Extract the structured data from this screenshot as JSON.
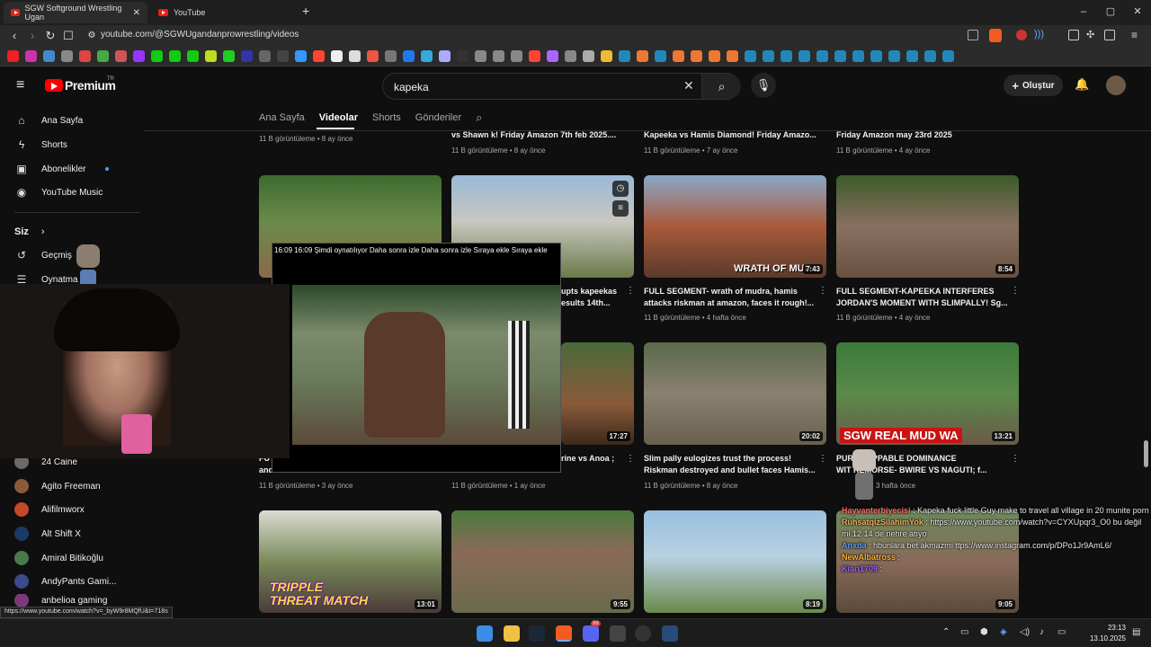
{
  "browser": {
    "tabs": [
      {
        "title": "SGW Softground Wrestling Ugan"
      },
      {
        "title": "YouTube"
      }
    ],
    "url": "youtube.com/@SGWUgandanprowrestling/videos",
    "status_url": "https://www.youtube.com/watch?v=_byW9r8MQfU&t=718s"
  },
  "masthead": {
    "logo_text": "Premium",
    "logo_region": "TR",
    "search_value": "kapeka",
    "create_label": "Oluştur"
  },
  "sidebar": {
    "primary": [
      {
        "label": "Ana Sayfa",
        "icon": "home-icon"
      },
      {
        "label": "Shorts",
        "icon": "shorts-icon"
      },
      {
        "label": "Abonelikler",
        "icon": "subscriptions-icon"
      },
      {
        "label": "YouTube Music",
        "icon": "music-icon"
      }
    ],
    "you_header": "Siz",
    "you_items": [
      {
        "label": "Geçmiş",
        "icon": "history-icon"
      },
      {
        "label": "Oynatma",
        "icon": "playlist-icon"
      }
    ],
    "channels": [
      {
        "label": "24 Caine",
        "color": "#6a6a6a"
      },
      {
        "label": "Agito Freeman",
        "color": "#8a5a3a"
      },
      {
        "label": "Alifilmworx",
        "color": "#c24a2a"
      },
      {
        "label": "Alt Shift X",
        "color": "#2a2a2a"
      },
      {
        "label": "Amiral Bitikoğlu",
        "color": "#4a7a4a"
      },
      {
        "label": "AndyPants Gami...",
        "color": "#3a4a8a"
      },
      {
        "label": "anbelioa gaming",
        "color": "#7a3a7a"
      }
    ]
  },
  "channel_tabs": [
    "Ana Sayfa",
    "Videolar",
    "Shorts",
    "Gönderiler"
  ],
  "top_row": [
    {
      "title": "",
      "meta": "11 B görüntüleme • 8 ay önce"
    },
    {
      "title": "vs Shawn k! Friday Amazon 7th feb 2025....",
      "meta": "11 B görüntüleme • 8 ay önce"
    },
    {
      "title": "Kapeeka vs Hamis Diamond! Friday Amazo...",
      "meta": "11 B görüntüleme • 7 ay önce"
    },
    {
      "title": "Friday Amazon may 23rd 2025",
      "meta": "11 B görüntüleme • 4 ay önce"
    }
  ],
  "row2": [
    {
      "title": "",
      "meta": "",
      "duration": ""
    },
    {
      "title": "upts kapeekas\nesults 14th...",
      "meta": "",
      "duration": ""
    },
    {
      "title": "FULL SEGMENT- wrath of mudra, hamis\nattacks riskman at amazon, faces it rough!...",
      "meta": "11 B görüntüleme • 4 hafta önce",
      "duration": "7:43",
      "overlay": "WRATH OF MUD..."
    },
    {
      "title": "FULL SEGMENT-KAPEEKA INTERFERES\nJORDAN'S MOMENT WITH SLIMPALLY! Sg...",
      "meta": "11 B görüntüleme • 4 ay önce",
      "duration": "8:54"
    }
  ],
  "row3": [
    {
      "title": "FU\nand",
      "meta": "11 B görüntüleme • 3 ay önce",
      "duration": ""
    },
    {
      "title": "rine vs Anoa ;",
      "meta": "11 B görüntüleme • 1 ay önce",
      "duration": "17:27"
    },
    {
      "title": "Slim pally eulogizes trust the process!\nRiskman destroyed and bullet faces Hamis...",
      "meta": "11 B görüntüleme • 8 ay önce",
      "duration": "20:02"
    },
    {
      "title": "PURE TOPPABLE DOMINANCE\nWIT REMORSE- BWIRE VS NAGUTI; f...",
      "meta": "3 hafta önce",
      "duration": "13:21",
      "overlay": "SGW REAL MUD WA"
    }
  ],
  "row4": [
    {
      "duration": "13:01",
      "overlay": "TRIPPLE THREAT MATCH"
    },
    {
      "duration": "9:55"
    },
    {
      "duration": "8:19"
    },
    {
      "duration": "9:05"
    }
  ],
  "miniplayer": {
    "header": "16:09 16:09 Şimdi oynatılıyor Daha sonra izle Daha sonra izle Sıraya ekle Sıraya ekle"
  },
  "chat": [
    {
      "user": "Hayvanterbiyecisi",
      "msg": ": Kapeka fuck little Guy make to travel all village in 20 munite porn"
    },
    {
      "user": "RuhsatqizSilahimYok",
      "msg": ": https://www.youtube.com/watch?v=CYXUpqr3_O0 bu değil mi 12 14 de nehre atıyo"
    },
    {
      "user": "Anxda",
      "msg": ": hbunlara bet akmazmı ttps://www.instagram.com/p/DPo1Jr9AmL6/"
    },
    {
      "user": "NewAlbatross",
      "msg": ":"
    },
    {
      "user": "Kiari1709",
      "msg": ":"
    }
  ],
  "taskbar": {
    "time": "23:13",
    "date": "13.10.2025",
    "notification_count": "99"
  }
}
